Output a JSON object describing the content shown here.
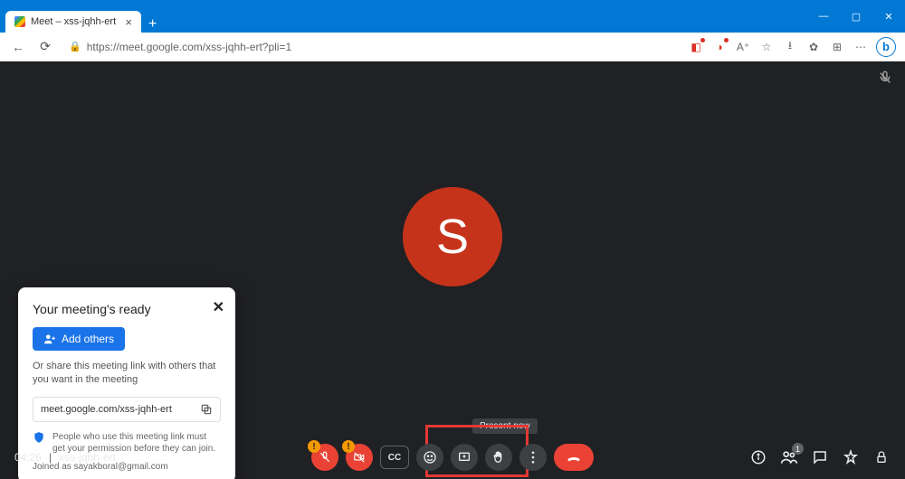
{
  "browser": {
    "tab_title": "Meet – xss-jqhh-ert",
    "url": "https://meet.google.com/xss-jqhh-ert?pli=1"
  },
  "meet": {
    "avatar_letter": "S",
    "mic_muted_corner": true,
    "tooltip_present": "Present now",
    "bottom": {
      "time": "04:26",
      "meeting_code": "xss-jqhh-ert",
      "participant_count": "1"
    },
    "popup": {
      "title": "Your meeting's ready",
      "add_others": "Add others",
      "share_text": "Or share this meeting link with others that you want in the meeting",
      "link": "meet.google.com/xss-jqhh-ert",
      "permission_text": "People who use this meeting link must get your permission before they can join.",
      "joined_as_prefix": "Joined as ",
      "joined_as_email": "sayakboral@gmail.com"
    }
  }
}
